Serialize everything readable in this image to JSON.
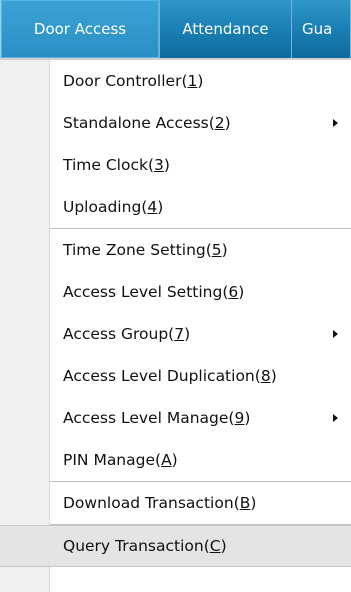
{
  "menubar": {
    "items": [
      {
        "label": "Door Access"
      },
      {
        "label": "Attendance"
      },
      {
        "label": "Gua"
      }
    ]
  },
  "menu": {
    "groups": [
      [
        {
          "label": "Door Controller(",
          "key": "1",
          "close": ")",
          "submenu": false
        },
        {
          "label": "Standalone Access(",
          "key": "2",
          "close": ")",
          "submenu": true
        },
        {
          "label": "Time Clock(",
          "key": "3",
          "close": ")",
          "submenu": false
        },
        {
          "label": "Uploading(",
          "key": "4",
          "close": ")",
          "submenu": false
        }
      ],
      [
        {
          "label": "Time Zone Setting(",
          "key": "5",
          "close": ")",
          "submenu": false
        },
        {
          "label": "Access Level Setting(",
          "key": "6",
          "close": ")",
          "submenu": false
        },
        {
          "label": "Access Group(",
          "key": "7",
          "close": ")",
          "submenu": true
        },
        {
          "label": "Access Level Duplication(",
          "key": "8",
          "close": ")",
          "submenu": false
        },
        {
          "label": "Access Level Manage(",
          "key": "9",
          "close": ")",
          "submenu": true
        },
        {
          "label": "PIN Manage(",
          "key": "A",
          "close": ")",
          "submenu": false
        }
      ],
      [
        {
          "label": "Download Transaction(",
          "key": "B",
          "close": ")",
          "submenu": false
        }
      ],
      [
        {
          "label": "Query Transaction(",
          "key": "C",
          "close": ")",
          "submenu": false,
          "highlighted": true
        }
      ]
    ]
  }
}
